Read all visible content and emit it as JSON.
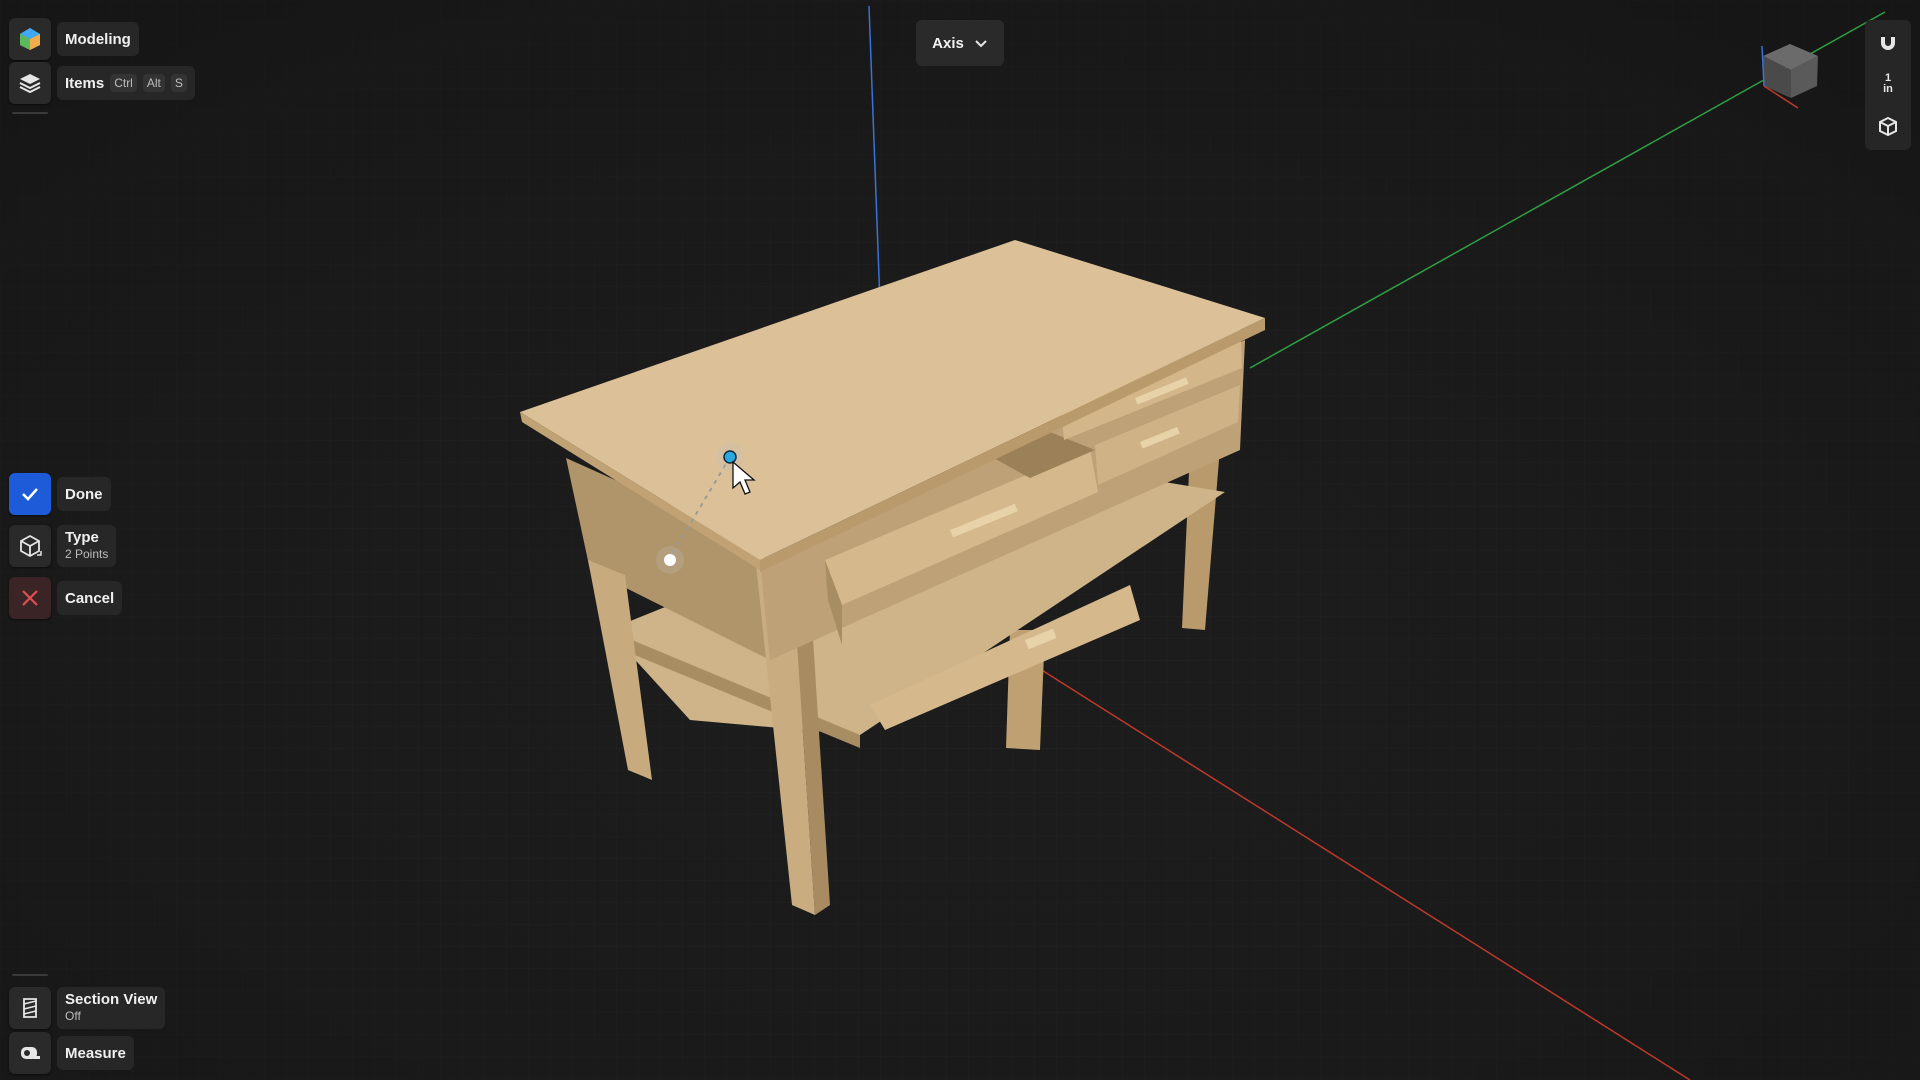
{
  "toolbar": {
    "mode_label": "Modeling",
    "items_label": "Items",
    "items_shortcut": [
      "Ctrl",
      "Alt",
      "S"
    ]
  },
  "axis_dropdown": {
    "selected": "Axis"
  },
  "measure_panel": {
    "done_label": "Done",
    "type_label": "Type",
    "type_value": "2 Points",
    "cancel_label": "Cancel"
  },
  "bottom_tools": {
    "section_view_label": "Section View",
    "section_view_value": "Off",
    "measure_label": "Measure"
  },
  "right_tools": {
    "unit_value": "1",
    "unit_label": "in"
  },
  "icons": {
    "modeling": "modeling-hexagon-icon",
    "items": "layers-icon",
    "done": "check-icon",
    "type": "cube-icon",
    "cancel": "close-icon",
    "section_view": "section-view-icon",
    "measure": "tape-measure-icon",
    "magnet": "magnet-icon",
    "view": "perspective-cube-icon",
    "nav_cube": "navigation-cube-icon",
    "dropdown": "chevron-down-icon"
  },
  "colors": {
    "accent_blue": "#1e5bd8",
    "cancel_red": "#e05050",
    "axis_x": "#c0392b",
    "axis_y": "#2ea043",
    "axis_z": "#3a72d6",
    "wood": "#d9bd90"
  }
}
